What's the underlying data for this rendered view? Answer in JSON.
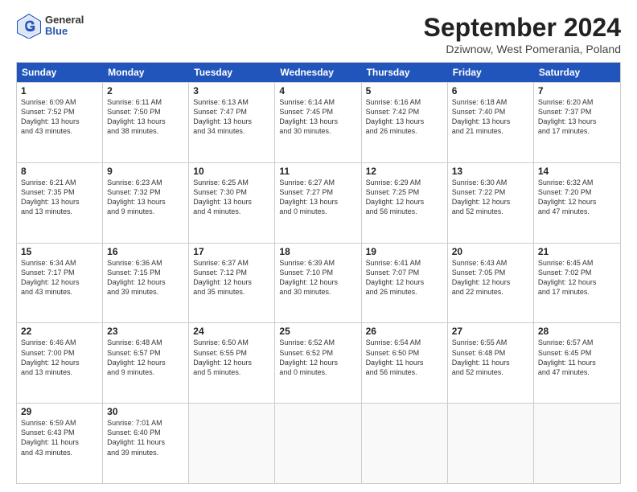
{
  "header": {
    "logo": {
      "general": "General",
      "blue": "Blue"
    },
    "title": "September 2024",
    "location": "Dziwnow, West Pomerania, Poland"
  },
  "weekdays": [
    "Sunday",
    "Monday",
    "Tuesday",
    "Wednesday",
    "Thursday",
    "Friday",
    "Saturday"
  ],
  "rows": [
    [
      {
        "day": "1",
        "lines": [
          "Sunrise: 6:09 AM",
          "Sunset: 7:52 PM",
          "Daylight: 13 hours",
          "and 43 minutes."
        ]
      },
      {
        "day": "2",
        "lines": [
          "Sunrise: 6:11 AM",
          "Sunset: 7:50 PM",
          "Daylight: 13 hours",
          "and 38 minutes."
        ]
      },
      {
        "day": "3",
        "lines": [
          "Sunrise: 6:13 AM",
          "Sunset: 7:47 PM",
          "Daylight: 13 hours",
          "and 34 minutes."
        ]
      },
      {
        "day": "4",
        "lines": [
          "Sunrise: 6:14 AM",
          "Sunset: 7:45 PM",
          "Daylight: 13 hours",
          "and 30 minutes."
        ]
      },
      {
        "day": "5",
        "lines": [
          "Sunrise: 6:16 AM",
          "Sunset: 7:42 PM",
          "Daylight: 13 hours",
          "and 26 minutes."
        ]
      },
      {
        "day": "6",
        "lines": [
          "Sunrise: 6:18 AM",
          "Sunset: 7:40 PM",
          "Daylight: 13 hours",
          "and 21 minutes."
        ]
      },
      {
        "day": "7",
        "lines": [
          "Sunrise: 6:20 AM",
          "Sunset: 7:37 PM",
          "Daylight: 13 hours",
          "and 17 minutes."
        ]
      }
    ],
    [
      {
        "day": "8",
        "lines": [
          "Sunrise: 6:21 AM",
          "Sunset: 7:35 PM",
          "Daylight: 13 hours",
          "and 13 minutes."
        ]
      },
      {
        "day": "9",
        "lines": [
          "Sunrise: 6:23 AM",
          "Sunset: 7:32 PM",
          "Daylight: 13 hours",
          "and 9 minutes."
        ]
      },
      {
        "day": "10",
        "lines": [
          "Sunrise: 6:25 AM",
          "Sunset: 7:30 PM",
          "Daylight: 13 hours",
          "and 4 minutes."
        ]
      },
      {
        "day": "11",
        "lines": [
          "Sunrise: 6:27 AM",
          "Sunset: 7:27 PM",
          "Daylight: 13 hours",
          "and 0 minutes."
        ]
      },
      {
        "day": "12",
        "lines": [
          "Sunrise: 6:29 AM",
          "Sunset: 7:25 PM",
          "Daylight: 12 hours",
          "and 56 minutes."
        ]
      },
      {
        "day": "13",
        "lines": [
          "Sunrise: 6:30 AM",
          "Sunset: 7:22 PM",
          "Daylight: 12 hours",
          "and 52 minutes."
        ]
      },
      {
        "day": "14",
        "lines": [
          "Sunrise: 6:32 AM",
          "Sunset: 7:20 PM",
          "Daylight: 12 hours",
          "and 47 minutes."
        ]
      }
    ],
    [
      {
        "day": "15",
        "lines": [
          "Sunrise: 6:34 AM",
          "Sunset: 7:17 PM",
          "Daylight: 12 hours",
          "and 43 minutes."
        ]
      },
      {
        "day": "16",
        "lines": [
          "Sunrise: 6:36 AM",
          "Sunset: 7:15 PM",
          "Daylight: 12 hours",
          "and 39 minutes."
        ]
      },
      {
        "day": "17",
        "lines": [
          "Sunrise: 6:37 AM",
          "Sunset: 7:12 PM",
          "Daylight: 12 hours",
          "and 35 minutes."
        ]
      },
      {
        "day": "18",
        "lines": [
          "Sunrise: 6:39 AM",
          "Sunset: 7:10 PM",
          "Daylight: 12 hours",
          "and 30 minutes."
        ]
      },
      {
        "day": "19",
        "lines": [
          "Sunrise: 6:41 AM",
          "Sunset: 7:07 PM",
          "Daylight: 12 hours",
          "and 26 minutes."
        ]
      },
      {
        "day": "20",
        "lines": [
          "Sunrise: 6:43 AM",
          "Sunset: 7:05 PM",
          "Daylight: 12 hours",
          "and 22 minutes."
        ]
      },
      {
        "day": "21",
        "lines": [
          "Sunrise: 6:45 AM",
          "Sunset: 7:02 PM",
          "Daylight: 12 hours",
          "and 17 minutes."
        ]
      }
    ],
    [
      {
        "day": "22",
        "lines": [
          "Sunrise: 6:46 AM",
          "Sunset: 7:00 PM",
          "Daylight: 12 hours",
          "and 13 minutes."
        ]
      },
      {
        "day": "23",
        "lines": [
          "Sunrise: 6:48 AM",
          "Sunset: 6:57 PM",
          "Daylight: 12 hours",
          "and 9 minutes."
        ]
      },
      {
        "day": "24",
        "lines": [
          "Sunrise: 6:50 AM",
          "Sunset: 6:55 PM",
          "Daylight: 12 hours",
          "and 5 minutes."
        ]
      },
      {
        "day": "25",
        "lines": [
          "Sunrise: 6:52 AM",
          "Sunset: 6:52 PM",
          "Daylight: 12 hours",
          "and 0 minutes."
        ]
      },
      {
        "day": "26",
        "lines": [
          "Sunrise: 6:54 AM",
          "Sunset: 6:50 PM",
          "Daylight: 11 hours",
          "and 56 minutes."
        ]
      },
      {
        "day": "27",
        "lines": [
          "Sunrise: 6:55 AM",
          "Sunset: 6:48 PM",
          "Daylight: 11 hours",
          "and 52 minutes."
        ]
      },
      {
        "day": "28",
        "lines": [
          "Sunrise: 6:57 AM",
          "Sunset: 6:45 PM",
          "Daylight: 11 hours",
          "and 47 minutes."
        ]
      }
    ],
    [
      {
        "day": "29",
        "lines": [
          "Sunrise: 6:59 AM",
          "Sunset: 6:43 PM",
          "Daylight: 11 hours",
          "and 43 minutes."
        ]
      },
      {
        "day": "30",
        "lines": [
          "Sunrise: 7:01 AM",
          "Sunset: 6:40 PM",
          "Daylight: 11 hours",
          "and 39 minutes."
        ]
      },
      {
        "day": "",
        "lines": []
      },
      {
        "day": "",
        "lines": []
      },
      {
        "day": "",
        "lines": []
      },
      {
        "day": "",
        "lines": []
      },
      {
        "day": "",
        "lines": []
      }
    ]
  ]
}
